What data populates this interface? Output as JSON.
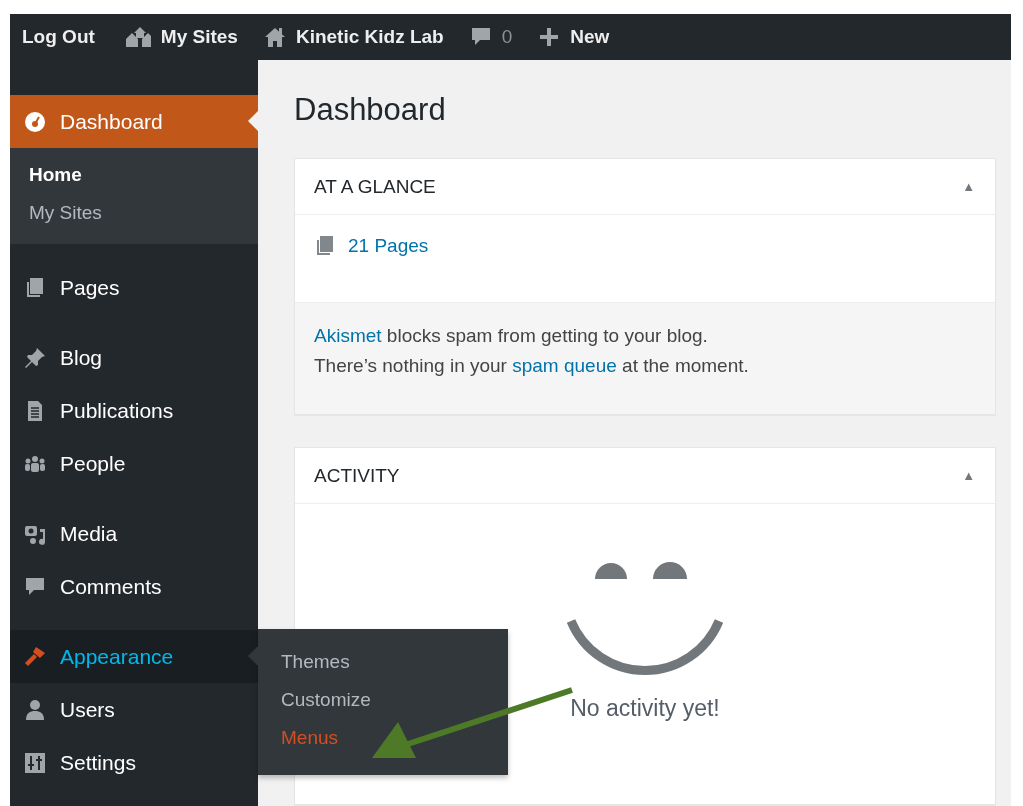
{
  "top_bar": {
    "items": [
      {
        "kind": "text",
        "label": "Log Out"
      },
      {
        "kind": "sites",
        "label": "My Sites"
      },
      {
        "kind": "home",
        "label": "Kinetic Kidz Lab"
      },
      {
        "kind": "comments",
        "label": "0"
      },
      {
        "kind": "new",
        "label": "New"
      }
    ]
  },
  "sidebar": {
    "groups": [
      {
        "items": [
          {
            "label": "Dashboard",
            "selected": true,
            "expanded": false,
            "children": [
              {
                "label": "Home",
                "selected": true
              },
              {
                "label": "My Sites",
                "selected": false
              }
            ]
          }
        ]
      },
      {
        "items": [
          {
            "label": "Pages",
            "selected": false,
            "expanded": false
          }
        ]
      },
      {
        "items": [
          {
            "label": "Blog",
            "selected": false,
            "expanded": false
          },
          {
            "label": "Publications",
            "selected": false,
            "expanded": false
          },
          {
            "label": "People",
            "selected": false,
            "expanded": false
          }
        ]
      },
      {
        "items": [
          {
            "label": "Media",
            "selected": false,
            "expanded": false
          },
          {
            "label": "Comments",
            "selected": false,
            "expanded": false
          }
        ]
      },
      {
        "items": [
          {
            "label": "Appearance",
            "selected": false,
            "expanded": true,
            "flyout": [
              {
                "label": "Themes",
                "selected": false
              },
              {
                "label": "Customize",
                "selected": false
              },
              {
                "label": "Menus",
                "selected": true
              }
            ]
          },
          {
            "label": "Users",
            "selected": false,
            "expanded": false
          },
          {
            "label": "Settings",
            "selected": false,
            "expanded": false
          }
        ]
      }
    ]
  },
  "main": {
    "title": "Dashboard",
    "at_a_glance": {
      "title": "AT A GLANCE",
      "toggle": "▲",
      "pages_link": "21 Pages",
      "notice_lines": [
        [
          {
            "text": "Akismet",
            "link": true
          },
          {
            "text": " blocks spam from getting to your blog.",
            "link": false
          }
        ],
        [
          {
            "text": "There’s nothing in your ",
            "link": false
          },
          {
            "text": "spam queue",
            "link": true
          },
          {
            "text": " at the moment.",
            "link": false
          }
        ]
      ]
    },
    "activity": {
      "title": "ACTIVITY",
      "toggle": "▲",
      "empty_message": "No activity yet!"
    }
  }
}
